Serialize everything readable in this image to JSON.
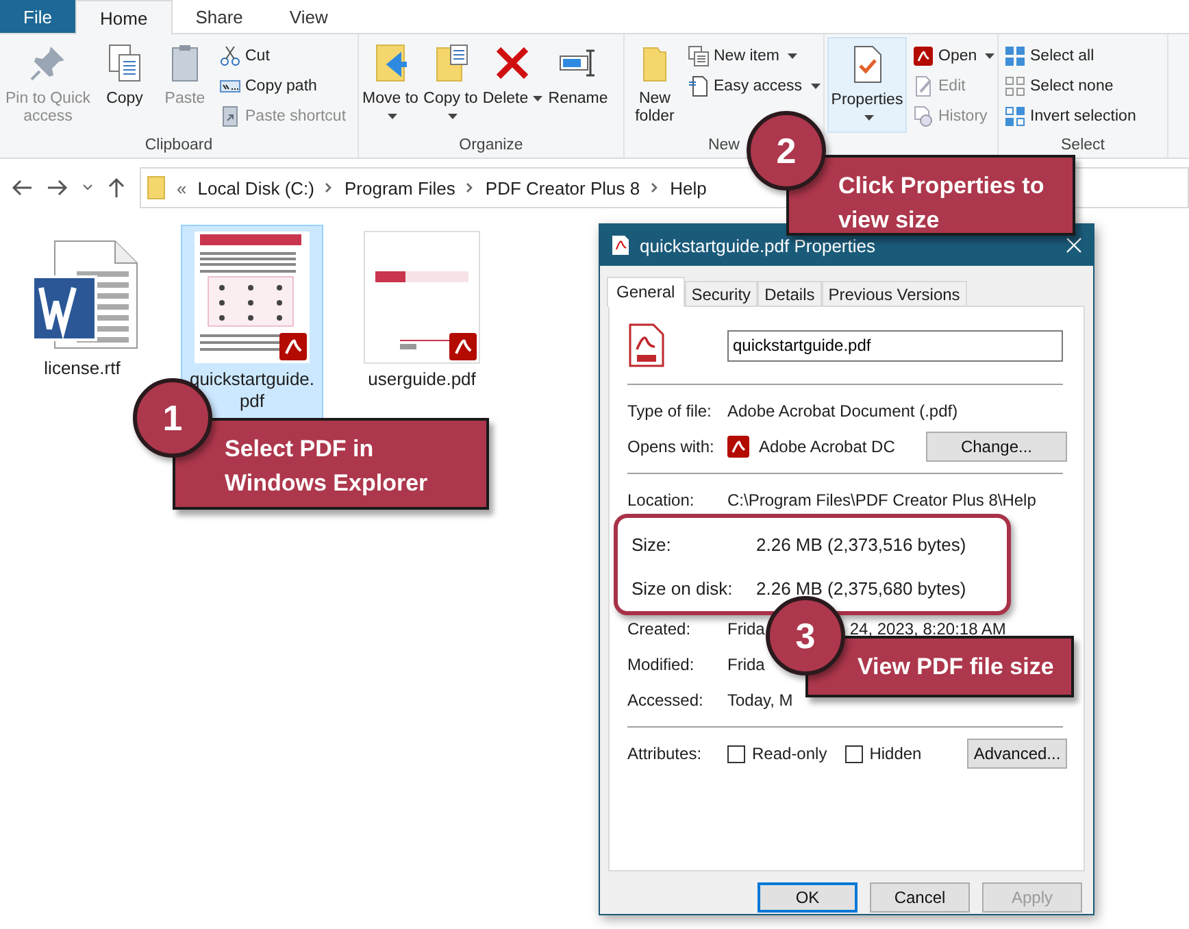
{
  "tabs": [
    {
      "label": "File",
      "kind": "menu",
      "selected": false
    },
    {
      "label": "Home",
      "kind": "tab",
      "selected": true
    },
    {
      "label": "Share",
      "kind": "tab",
      "selected": false
    },
    {
      "label": "View",
      "kind": "tab",
      "selected": false
    }
  ],
  "ribbon": [
    {
      "label": "Clipboard",
      "large": [
        {
          "label": "Pin to Quick access",
          "disabled": true,
          "dropdown": false,
          "selected": false
        },
        {
          "label": "Copy",
          "disabled": false,
          "dropdown": false,
          "selected": false
        },
        {
          "label": "Paste",
          "disabled": true,
          "dropdown": false,
          "selected": false
        }
      ],
      "small": [
        {
          "label": "Cut",
          "disabled": false,
          "dropdown": false
        },
        {
          "label": "Copy path",
          "disabled": false,
          "dropdown": false
        },
        {
          "label": "Paste shortcut",
          "disabled": true,
          "dropdown": false
        }
      ]
    },
    {
      "label": "Organize",
      "large": [
        {
          "label": "Move to",
          "disabled": false,
          "dropdown": true,
          "selected": false
        },
        {
          "label": "Copy to",
          "disabled": false,
          "dropdown": true,
          "selected": false
        },
        {
          "label": "Delete",
          "disabled": false,
          "dropdown": true,
          "selected": false
        },
        {
          "label": "Rename",
          "disabled": false,
          "dropdown": false,
          "selected": false
        }
      ]
    },
    {
      "label": "New",
      "large": [
        {
          "label": "New folder",
          "disabled": false,
          "dropdown": false,
          "selected": false
        }
      ],
      "small": [
        {
          "label": "New item",
          "disabled": false,
          "dropdown": true
        },
        {
          "label": "Easy access",
          "disabled": false,
          "dropdown": true
        }
      ]
    },
    {
      "large": [
        {
          "label": "Properties",
          "disabled": false,
          "dropdown": true,
          "selected": true
        }
      ],
      "small": [
        {
          "label": "Open",
          "disabled": false,
          "dropdown": true
        },
        {
          "label": "Edit",
          "disabled": true,
          "dropdown": false
        },
        {
          "label": "History",
          "disabled": true,
          "dropdown": false
        }
      ]
    },
    {
      "label": "Select",
      "small": [
        {
          "label": "Select all",
          "disabled": false,
          "dropdown": false
        },
        {
          "label": "Select none",
          "disabled": false,
          "dropdown": false
        },
        {
          "label": "Invert selection",
          "disabled": false,
          "dropdown": false
        }
      ]
    }
  ],
  "address": {
    "overflow": "«",
    "path": [
      "Local Disk (C:)",
      "Program Files",
      "PDF Creator Plus 8",
      "Help"
    ]
  },
  "files": [
    {
      "name": "license.rtf",
      "kind": "word",
      "selected": false
    },
    {
      "name": "quickstartguide.pdf",
      "kind": "guide",
      "selected": true
    },
    {
      "name": "userguide.pdf",
      "kind": "cover",
      "selected": false
    }
  ],
  "dialog": {
    "title": "quickstartguide.pdf Properties",
    "tabs": [
      {
        "label": "General",
        "selected": true
      },
      {
        "label": "Security",
        "selected": false
      },
      {
        "label": "Details",
        "selected": false
      },
      {
        "label": "Previous Versions",
        "selected": false
      }
    ],
    "filename": "quickstartguide.pdf",
    "type": {
      "label": "Type of file:",
      "value": "Adobe Acrobat Document (.pdf)"
    },
    "opens_with": {
      "label": "Opens with:",
      "value": "Adobe Acrobat DC",
      "button": "Change..."
    },
    "location": {
      "label": "Location:",
      "value": "C:\\Program Files\\PDF Creator Plus 8\\Help"
    },
    "size": [
      {
        "label": "Size:",
        "value": "2.26 MB (2,373,516 bytes)"
      },
      {
        "label": "Size on disk:",
        "value": "2.26 MB (2,375,680 bytes)"
      }
    ],
    "dates": [
      {
        "label": "Created:",
        "parts": [
          "Frida",
          "24, 2023, 8:20:18 AM"
        ]
      },
      {
        "label": "Modified:",
        "parts": [
          "Frida"
        ]
      },
      {
        "label": "Accessed:",
        "parts": [
          "Today, M"
        ]
      }
    ],
    "attributes": {
      "label": "Attributes:",
      "options": [
        {
          "label": "Read-only",
          "checked": false
        },
        {
          "label": "Hidden",
          "checked": false
        }
      ],
      "button": "Advanced..."
    },
    "buttons": [
      {
        "label": "OK",
        "default": true,
        "disabled": false
      },
      {
        "label": "Cancel",
        "default": false,
        "disabled": false
      },
      {
        "label": "Apply",
        "default": false,
        "disabled": true
      }
    ]
  },
  "callouts": [
    {
      "number": "1",
      "text": "Select PDF in Windows Explorer"
    },
    {
      "number": "2",
      "text": "Click Properties to view size"
    },
    {
      "number": "3",
      "text": "View PDF file size"
    }
  ]
}
